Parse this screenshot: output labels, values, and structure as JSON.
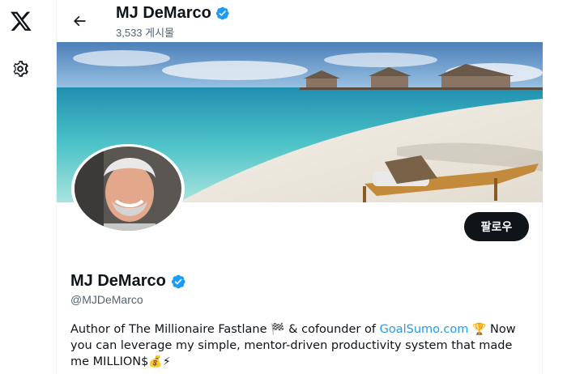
{
  "nav": {
    "logo_icon": "x-logo-icon",
    "settings_icon": "gear-icon"
  },
  "header": {
    "back_icon": "arrow-left-icon",
    "name": "MJ DeMarco",
    "posts_count": "3,533 게시물"
  },
  "profile": {
    "name": "MJ DeMarco",
    "handle": "@MJDeMarco",
    "follow_label": "팔로우",
    "verified_color": "#1d9bf0",
    "bio": {
      "part1": "Author of The Millionaire Fastlane ",
      "emoji1": "🏁",
      "part2": " & cofounder of ",
      "link": "GoalSumo.com",
      "emoji2": "🏆",
      "part3": " Now you can leverage my simple, mentor-driven productivity system that made me MILLION$",
      "emoji3": "💰",
      "emoji4": "⚡"
    }
  },
  "colors": {
    "accent": "#1d9bf0",
    "text": "#0f1419",
    "secondary": "#536471"
  }
}
